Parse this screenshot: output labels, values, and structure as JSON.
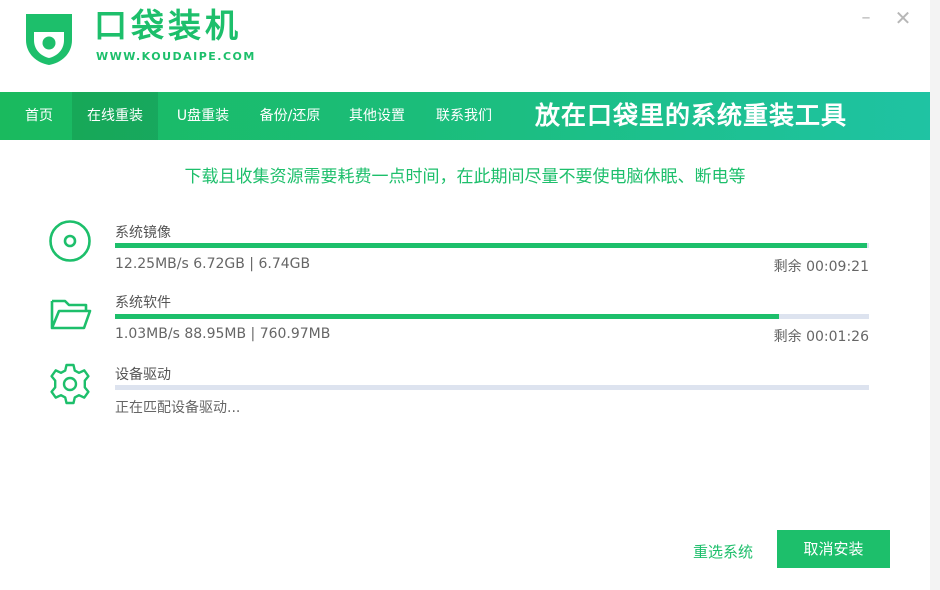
{
  "app": {
    "brand_name": "口袋装机",
    "brand_url": "WWW.KOUDAIPE.COM",
    "logo_icon": "shield-logo-icon",
    "accent_color": "#1dbf6b"
  },
  "window_controls": {
    "minimize_glyph": "–",
    "close_glyph": "✕"
  },
  "nav": {
    "items": [
      {
        "label": "首页"
      },
      {
        "label": "在线重装"
      },
      {
        "label": "U盘重装"
      },
      {
        "label": "备份/还原"
      },
      {
        "label": "其他设置"
      },
      {
        "label": "联系我们"
      }
    ],
    "active_index": 1,
    "slogan": "放在口袋里的系统重装工具"
  },
  "notice": "下载且收集资源需要耗费一点时间，在此期间尽量不要使电脑休眠、断电等",
  "tasks": [
    {
      "icon": "disc-icon",
      "title": "系统镜像",
      "stats": "12.25MB/s 6.72GB | 6.74GB",
      "remaining": "剩余 00:09:21",
      "progress": 0.997
    },
    {
      "icon": "folder-icon",
      "title": "系统软件",
      "stats": "1.03MB/s 88.95MB | 760.97MB",
      "remaining": "剩余 00:01:26",
      "progress": 0.88
    },
    {
      "icon": "gear-icon",
      "title": "设备驱动",
      "stats": "正在匹配设备驱动...",
      "remaining": "",
      "progress": 0
    }
  ],
  "footer": {
    "reselect_label": "重选系统",
    "cancel_label": "取消安装"
  }
}
